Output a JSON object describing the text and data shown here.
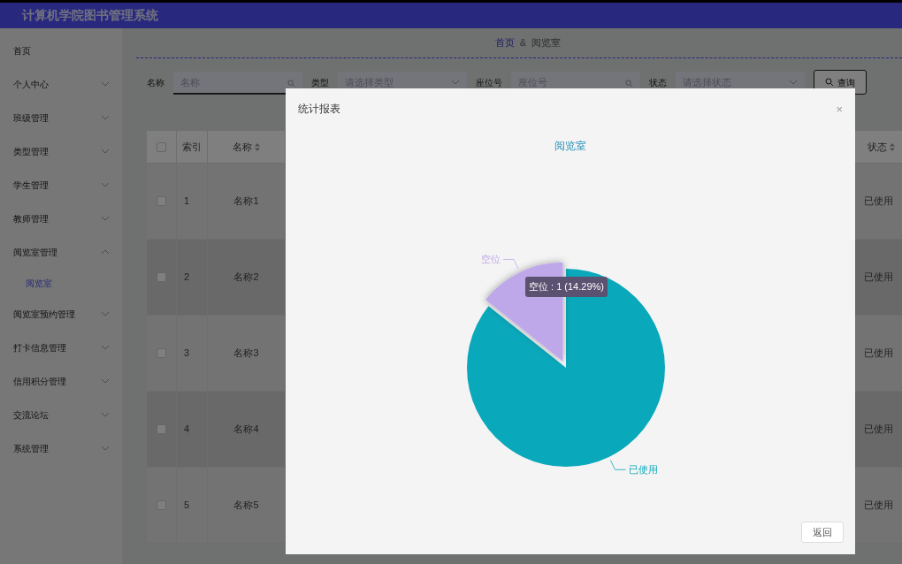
{
  "header": {
    "title": "计算机学院图书管理系统"
  },
  "sidebar": {
    "items": [
      {
        "label": "首页",
        "kind": "link"
      },
      {
        "label": "个人中心",
        "kind": "menu",
        "expanded": false
      },
      {
        "label": "班级管理",
        "kind": "menu",
        "expanded": false
      },
      {
        "label": "类型管理",
        "kind": "menu",
        "expanded": false
      },
      {
        "label": "学生管理",
        "kind": "menu",
        "expanded": false
      },
      {
        "label": "教师管理",
        "kind": "menu",
        "expanded": false
      },
      {
        "label": "阅览室管理",
        "kind": "menu",
        "expanded": true,
        "children": [
          {
            "label": "阅览室",
            "selected": true
          }
        ]
      },
      {
        "label": "阅览室预约管理",
        "kind": "menu",
        "expanded": false
      },
      {
        "label": "打卡信息管理",
        "kind": "menu",
        "expanded": false
      },
      {
        "label": "信用积分管理",
        "kind": "menu",
        "expanded": false
      },
      {
        "label": "交流论坛",
        "kind": "menu",
        "expanded": false
      },
      {
        "label": "系统管理",
        "kind": "menu",
        "expanded": false
      }
    ]
  },
  "breadcrumb": [
    "首页",
    "阅览室"
  ],
  "breadcrumb_separator": "&",
  "filters": [
    {
      "label": "名称",
      "placeholder": "名称",
      "kind": "text"
    },
    {
      "label": "类型",
      "placeholder": "请选择类型",
      "kind": "select"
    },
    {
      "label": "座位号",
      "placeholder": "座位号",
      "kind": "text"
    },
    {
      "label": "状态",
      "placeholder": "请选择状态",
      "kind": "select"
    }
  ],
  "search_button": "查询",
  "table": {
    "all_checked": false,
    "columns": [
      {
        "label": "索引",
        "sortable": false
      },
      {
        "label": "名称",
        "sortable": true
      },
      {
        "label": "状态",
        "sortable": true
      }
    ],
    "rows": [
      {
        "cells": [
          "1",
          "名称1",
          "已使用"
        ],
        "checked": false
      },
      {
        "cells": [
          "2",
          "名称2",
          "已使用"
        ],
        "checked": false
      },
      {
        "cells": [
          "3",
          "名称3",
          "已使用"
        ],
        "checked": false
      },
      {
        "cells": [
          "4",
          "名称4",
          "已使用"
        ],
        "checked": false
      },
      {
        "cells": [
          "5",
          "名称5",
          "已使用"
        ],
        "checked": false
      }
    ]
  },
  "dialog": {
    "title": "统计报表",
    "close": "×",
    "button": "返回",
    "chart_data": {
      "type": "pie",
      "title": "阅览室",
      "categories": [
        "已使用",
        "空位"
      ],
      "values": [
        85.71,
        14.29
      ],
      "colors": [
        "#0aa8bb",
        "#bea8ea"
      ]
    },
    "tooltip": "空位 : 1 (14.29%)"
  }
}
